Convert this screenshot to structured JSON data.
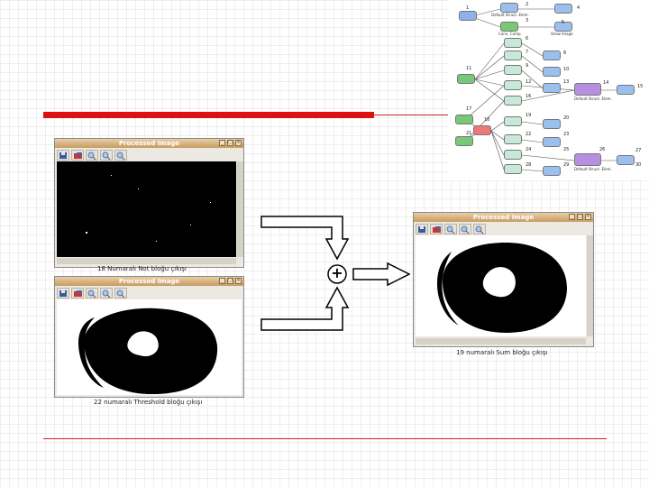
{
  "slide": {
    "colors": {
      "accent_red": "#dd1111",
      "line_red": "#cc2222"
    }
  },
  "windows": {
    "not": {
      "title": "Processed Image",
      "caption": "18 Numaralı Not bloğu çıkışı"
    },
    "threshold": {
      "title": "Processed Image",
      "caption": "22 numaralı Threshold bloğu çıkışı"
    },
    "sum": {
      "title": "Processed Image",
      "caption": "19 numaralı Sum bloğu çıkışı"
    },
    "toolbar_icons": [
      "save-icon",
      "open-icon",
      "zoom-in-icon",
      "zoom-out-icon",
      "zoom-fit-icon"
    ]
  },
  "operator": {
    "symbol": "+"
  },
  "diagram": {
    "node_labels": {
      "n1": "Default Struct. Elem.",
      "n2": "Conn. Comp.",
      "n3": "Show Image",
      "n4": "Show Image",
      "n5": "Show Image",
      "n6": "Default Struct. Elem.",
      "n7": "Default Struct. Elem."
    },
    "numbers": [
      "1",
      "2",
      "3",
      "4",
      "5",
      "6",
      "7",
      "8",
      "9",
      "10",
      "11",
      "12",
      "13",
      "14",
      "15",
      "16",
      "17",
      "18",
      "19",
      "20",
      "21",
      "22",
      "23",
      "24",
      "25",
      "26",
      "27",
      "28",
      "29",
      "30"
    ]
  }
}
